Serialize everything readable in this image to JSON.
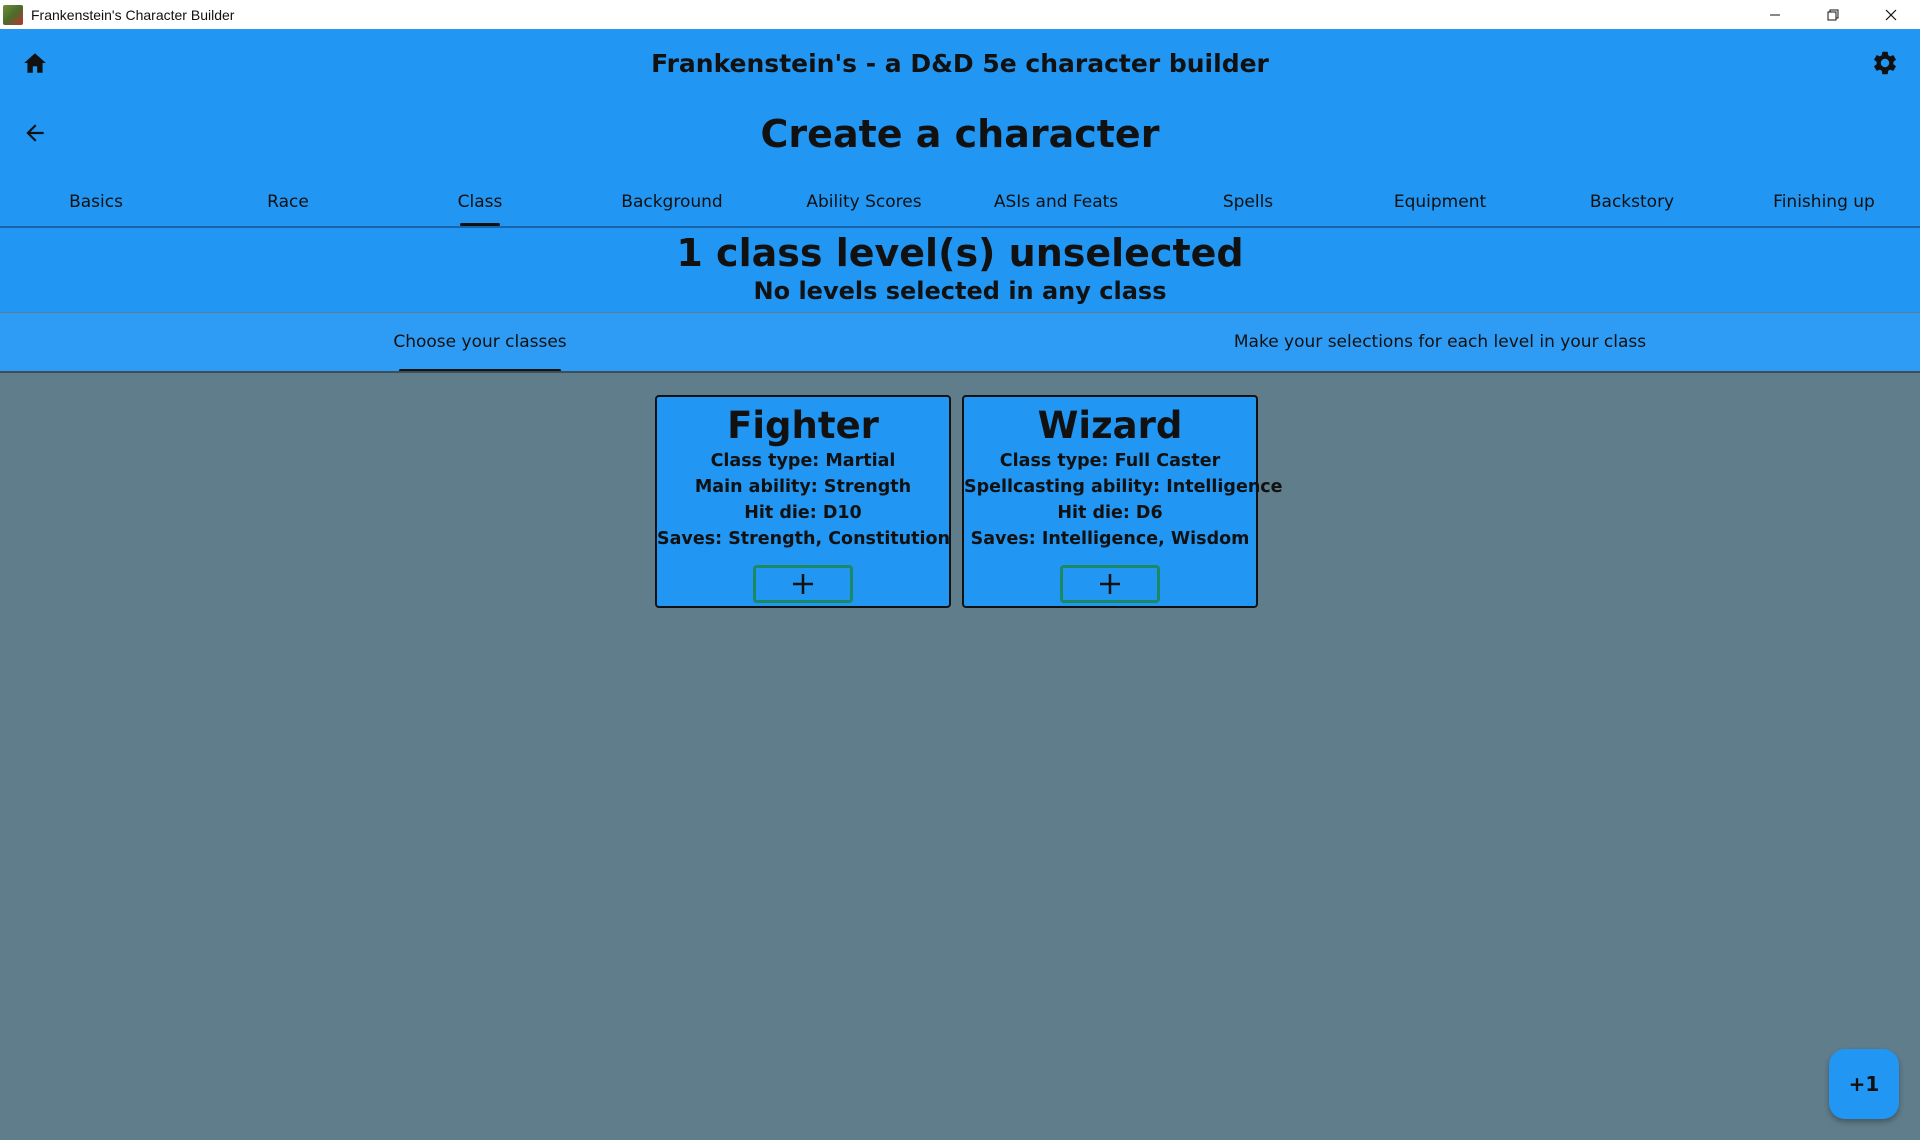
{
  "window": {
    "title": "Frankenstein's Character Builder"
  },
  "header": {
    "app_title": "Frankenstein's - a D&D 5e character builder",
    "page_title": "Create a character"
  },
  "tabs": [
    {
      "label": "Basics"
    },
    {
      "label": "Race"
    },
    {
      "label": "Class"
    },
    {
      "label": "Background"
    },
    {
      "label": "Ability Scores"
    },
    {
      "label": "ASIs and Feats"
    },
    {
      "label": "Spells"
    },
    {
      "label": "Equipment"
    },
    {
      "label": "Backstory"
    },
    {
      "label": "Finishing up"
    }
  ],
  "active_tab": "Class",
  "status": {
    "main": "1 class level(s) unselected",
    "sub": "No levels selected in any class"
  },
  "subtabs": [
    {
      "label": "Choose your classes"
    },
    {
      "label": "Make your selections for each level in your class"
    }
  ],
  "cards": [
    {
      "name": "Fighter",
      "line1": "Class type: Martial",
      "line2": "Main ability: Strength",
      "line3": "Hit die: D10",
      "line4": "Saves: Strength, Constitution"
    },
    {
      "name": "Wizard",
      "line1": "Class type: Full Caster",
      "line2": "Spellcasting ability: Intelligence",
      "line3": "Hit die: D6",
      "line4": "Saves: Intelligence, Wisdom"
    }
  ],
  "fab": {
    "label": "+1"
  },
  "colors": {
    "primary": "#2196f3",
    "background": "#607d8b",
    "add_button_border": "#1b8a64"
  }
}
